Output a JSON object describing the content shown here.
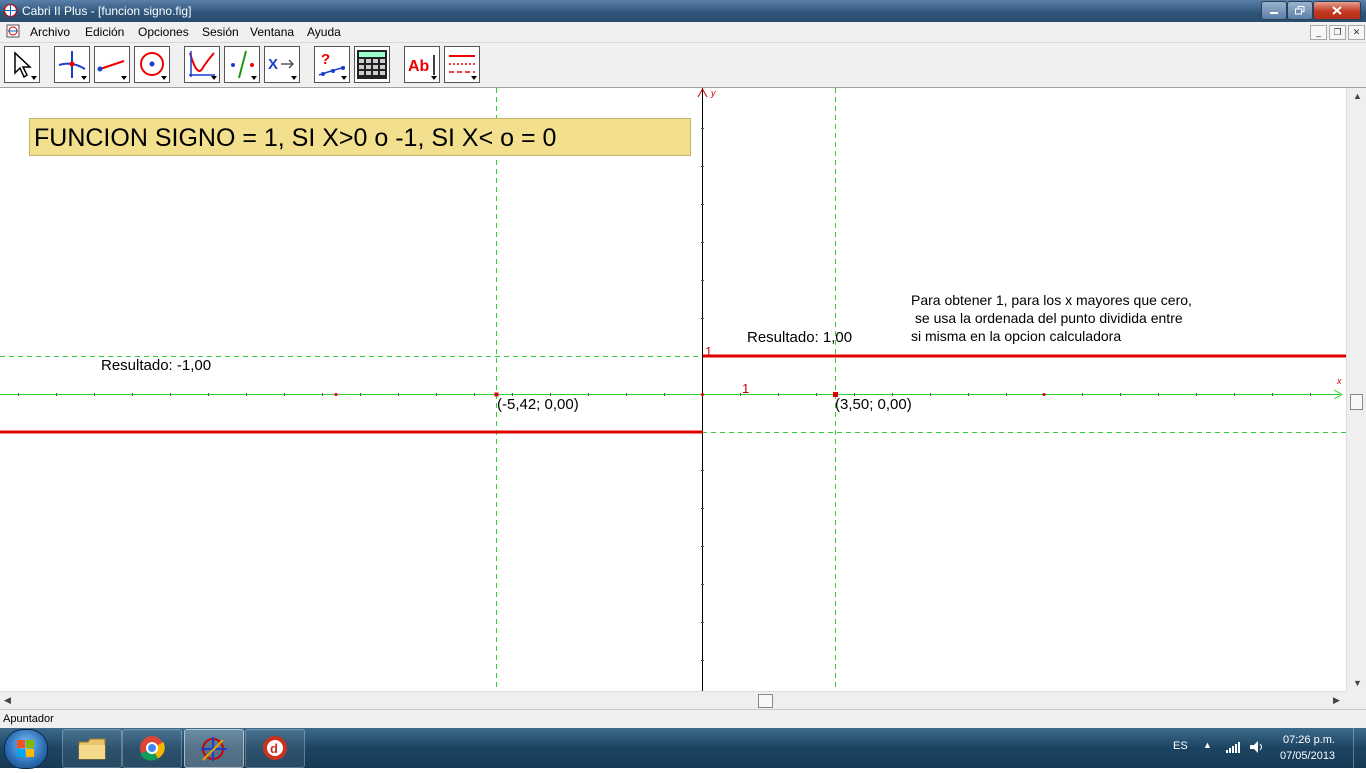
{
  "window": {
    "title": "Cabri II Plus - [funcion signo.fig]"
  },
  "menu": [
    "Archivo",
    "Edición",
    "Opciones",
    "Sesión",
    "Ventana",
    "Ayuda"
  ],
  "toolbar": {
    "tools": [
      "pointer-tool",
      "points-tool",
      "lines-tool",
      "curves-tool",
      "constructions-tool",
      "transformations-tool",
      "macro-tool",
      "properties-tool",
      "measure-tool",
      "display-tool",
      "attributes-tool"
    ]
  },
  "canvas": {
    "heading": "FUNCION SIGNO = 1, SI X>0 o -1, SI X< o = 0",
    "result_left": "Resultado: -1,00",
    "result_right": "Resultado: 1,00",
    "point_left": "(-5,42; 0,00)",
    "point_right": "(3,50; 0,00)",
    "axis_x_label": "x",
    "axis_y_label": "y",
    "unit_x": "1",
    "unit_y": "1",
    "note": [
      "Para obtener 1, para los x mayores que cero,",
      " se usa la ordenada del punto dividida entre",
      "si misma en la opcion calculadora"
    ],
    "colors": {
      "function": "#e00000",
      "guides": "#33cc33",
      "axes": "#000000",
      "heading_bg": "#f2e08e"
    }
  },
  "statusbar": {
    "text": "Apuntador"
  },
  "taskbar": {
    "apps": [
      "windows-explorer",
      "google-chrome",
      "cabri-ii-plus",
      "dreamweaver"
    ],
    "language": "ES",
    "time": "07:26 p.m.",
    "date": "07/05/2013"
  }
}
